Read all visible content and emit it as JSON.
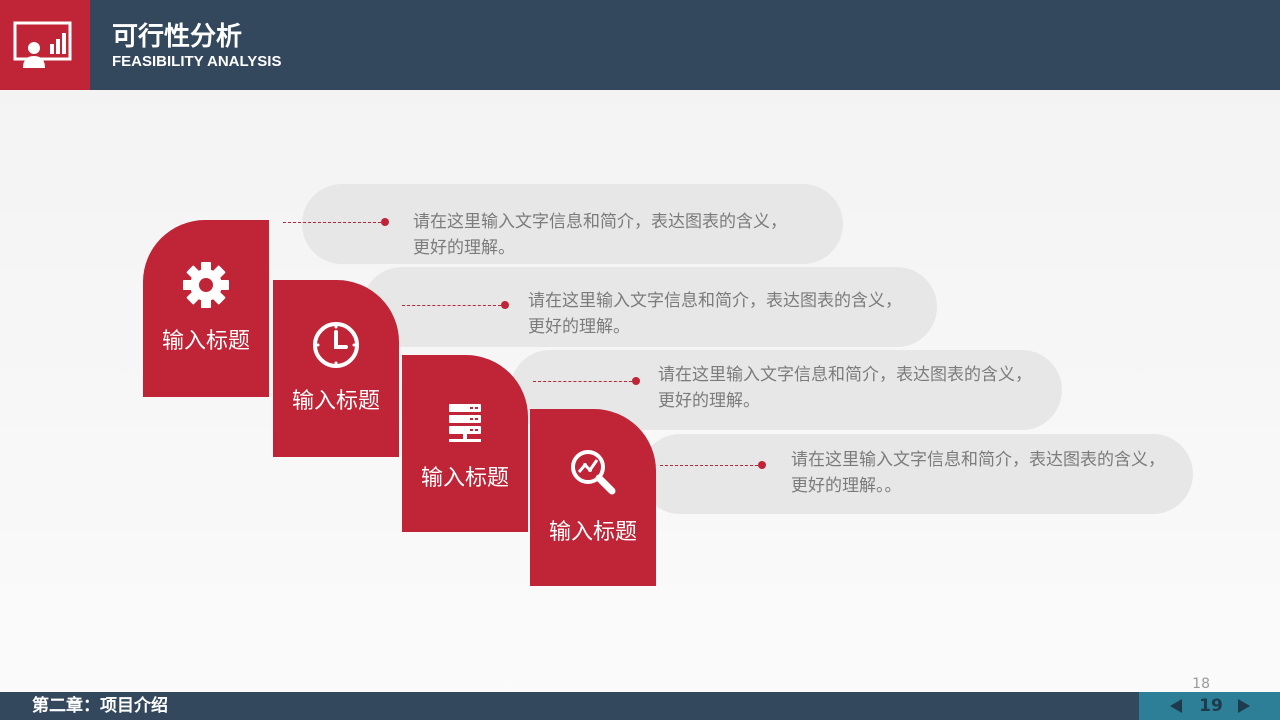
{
  "header": {
    "title": "可行性分析",
    "subtitle": "FEASIBILITY ANALYSIS",
    "icon": "presentation-chart-icon"
  },
  "items": [
    {
      "label": "输入标题",
      "icon": "gear-icon",
      "text": "请在这里输入文字信息和简介，表达图表的含义，更好的理解。"
    },
    {
      "label": "输入标题",
      "icon": "clock-icon",
      "text": "请在这里输入文字信息和简介，表达图表的含义，更好的理解。"
    },
    {
      "label": "输入标题",
      "icon": "server-icon",
      "text": "请在这里输入文字信息和简介，表达图表的含义，更好的理解。"
    },
    {
      "label": "输入标题",
      "icon": "search-chart-icon",
      "text": "请在这里输入文字信息和简介，表达图表的含义，更好的理解。。"
    }
  ],
  "footer": {
    "chapter": "第二章：项目介绍",
    "page": "19",
    "slide_number": "18"
  },
  "colors": {
    "accent": "#bf2537",
    "header": "#33475d",
    "pager": "#2d7f97",
    "pill": "#e7e7e7"
  }
}
